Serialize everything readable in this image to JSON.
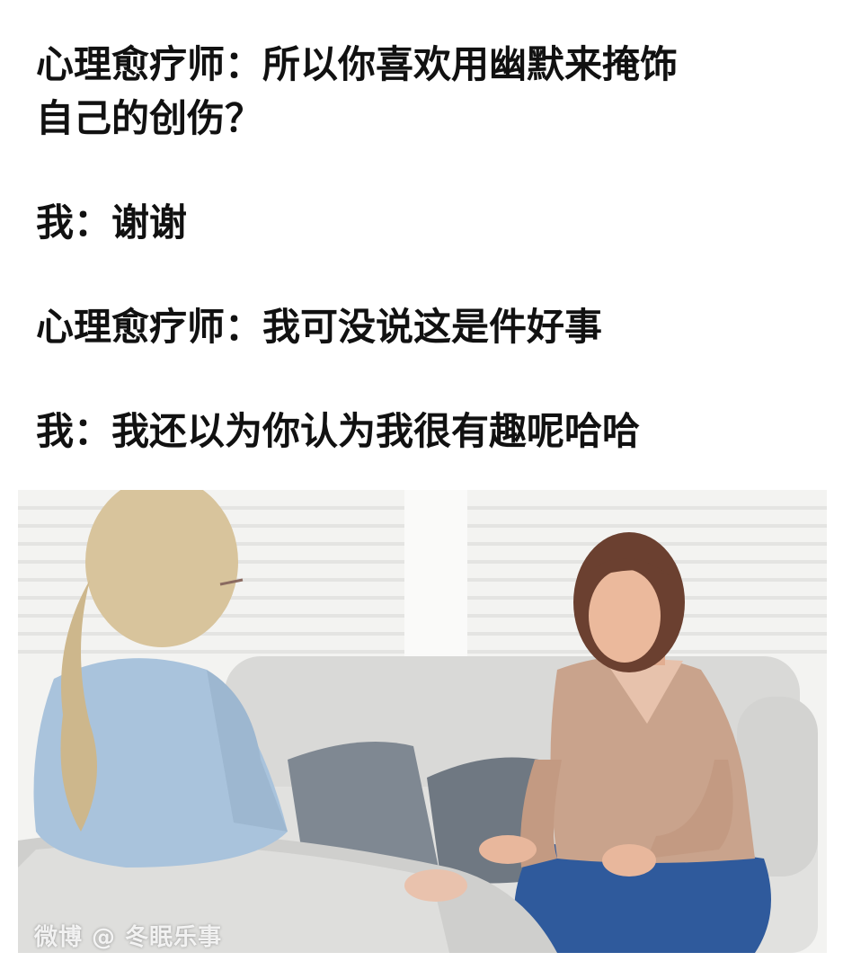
{
  "dialogue": {
    "line1a": "心理愈疗师：所以你喜欢用幽默来掩饰",
    "line1b": "自己的创伤？",
    "line2": "我：谢谢",
    "line3": "心理愈疗师：我可没说这是件好事",
    "line4": "我：我还以为你认为我很有趣呢哈哈"
  },
  "watermark": "微博 @ 冬眠乐事",
  "colors": {
    "text": "#111111",
    "sofa": "#dcdcda",
    "pillow": "#7d8690",
    "blouse": "#c9a38c",
    "jeans": "#2f5a9c",
    "shirt": "#a9c3dc",
    "hair_blonde": "#d8c49c",
    "hair_brown": "#6b4030"
  }
}
